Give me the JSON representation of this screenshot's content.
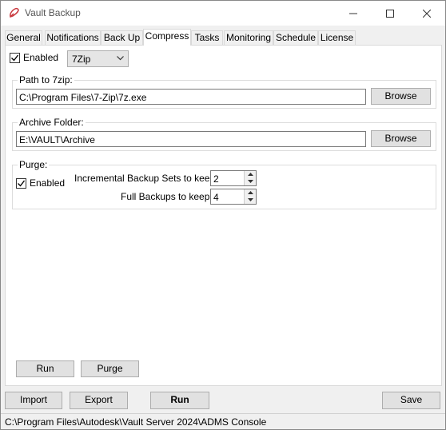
{
  "window": {
    "title": "Vault Backup"
  },
  "tabs": [
    "General",
    "Notifications",
    "Back Up",
    "Compress",
    "Tasks",
    "Monitoring",
    "Schedule",
    "License"
  ],
  "active_tab": "Compress",
  "compress": {
    "enabled_label": "Enabled",
    "enabled_checked": true,
    "tool_selected": "7Zip",
    "path_group": {
      "title": "Path to 7zip:",
      "value": "C:\\Program Files\\7-Zip\\7z.exe",
      "browse": "Browse"
    },
    "archive_group": {
      "title": "Archive Folder:",
      "value": "E:\\VAULT\\Archive",
      "browse": "Browse"
    },
    "purge_group": {
      "title": "Purge:",
      "enabled_label": "Enabled",
      "enabled_checked": true,
      "incremental_label": "Incremental Backup Sets to keep:",
      "incremental_value": "2",
      "full_label": "Full Backups to keep:",
      "full_value": "4"
    },
    "run_button": "Run",
    "purge_button": "Purge"
  },
  "footer": {
    "import": "Import",
    "export": "Export",
    "run": "Run",
    "save": "Save"
  },
  "status": {
    "path": "C:\\Program Files\\Autodesk\\Vault Server 2024\\ADMS Console"
  }
}
